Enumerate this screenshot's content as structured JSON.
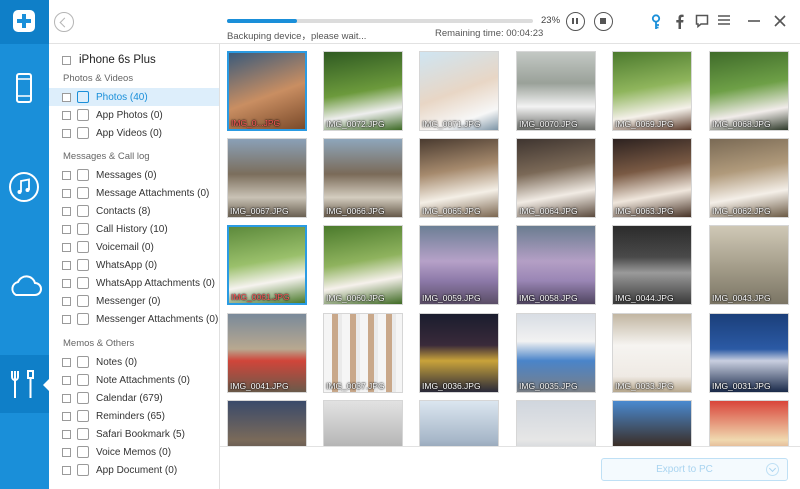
{
  "topbar": {
    "progress_percent": "23%",
    "progress_fraction": 0.23,
    "status": "Backuping device，please wait...",
    "remaining": "Remaining time: 00:04:23"
  },
  "device": {
    "name": "iPhone 6s Plus"
  },
  "sections": {
    "photos_videos": "Photos & Videos",
    "messages_calllog": "Messages & Call log",
    "memos_others": "Memos & Others"
  },
  "items": [
    {
      "label": "Photos (40)"
    },
    {
      "label": "App Photos (0)"
    },
    {
      "label": "App Videos (0)"
    },
    {
      "label": "Messages (0)"
    },
    {
      "label": "Message Attachments (0)"
    },
    {
      "label": "Contacts (8)"
    },
    {
      "label": "Call History (10)"
    },
    {
      "label": "Voicemail (0)"
    },
    {
      "label": "WhatsApp (0)"
    },
    {
      "label": "WhatsApp Attachments (0)"
    },
    {
      "label": "Messenger (0)"
    },
    {
      "label": "Messenger Attachments (0)"
    },
    {
      "label": "Notes (0)"
    },
    {
      "label": "Note Attachments (0)"
    },
    {
      "label": "Calendar (679)"
    },
    {
      "label": "Reminders (65)"
    },
    {
      "label": "Safari Bookmark (5)"
    },
    {
      "label": "Voice Memos (0)"
    },
    {
      "label": "App Document (0)"
    }
  ],
  "photos": [
    {
      "name": "IMG_0...JPG"
    },
    {
      "name": "IMG_0072.JPG"
    },
    {
      "name": "IMG_0071.JPG"
    },
    {
      "name": "IMG_0070.JPG"
    },
    {
      "name": "IMG_0069.JPG"
    },
    {
      "name": "IMG_0068.JPG"
    },
    {
      "name": "IMG_0067.JPG"
    },
    {
      "name": "IMG_0066.JPG"
    },
    {
      "name": "IMG_0065.JPG"
    },
    {
      "name": "IMG_0064.JPG"
    },
    {
      "name": "IMG_0063.JPG"
    },
    {
      "name": "IMG_0062.JPG"
    },
    {
      "name": "IMG_0061.JPG"
    },
    {
      "name": "IMG_0060.JPG"
    },
    {
      "name": "IMG_0059.JPG"
    },
    {
      "name": "IMG_0058.JPG"
    },
    {
      "name": "IMG_0044.JPG"
    },
    {
      "name": "IMG_0043.JPG"
    },
    {
      "name": "IMG_0041.JPG"
    },
    {
      "name": "IMG_0037.JPG"
    },
    {
      "name": "IMG_0036.JPG"
    },
    {
      "name": "IMG_0035.JPG"
    },
    {
      "name": "IMG_0033.JPG"
    },
    {
      "name": "IMG_0031.JPG"
    },
    {
      "name": ""
    },
    {
      "name": ""
    },
    {
      "name": ""
    },
    {
      "name": ""
    },
    {
      "name": ""
    },
    {
      "name": ""
    }
  ],
  "footer": {
    "export_label": "Export to PC"
  },
  "colors": {
    "accent": "#1a8fd9",
    "rail": "#1a8fd9",
    "selected_row": "#ddeefb",
    "caption_selected": "#ff5a5a"
  }
}
